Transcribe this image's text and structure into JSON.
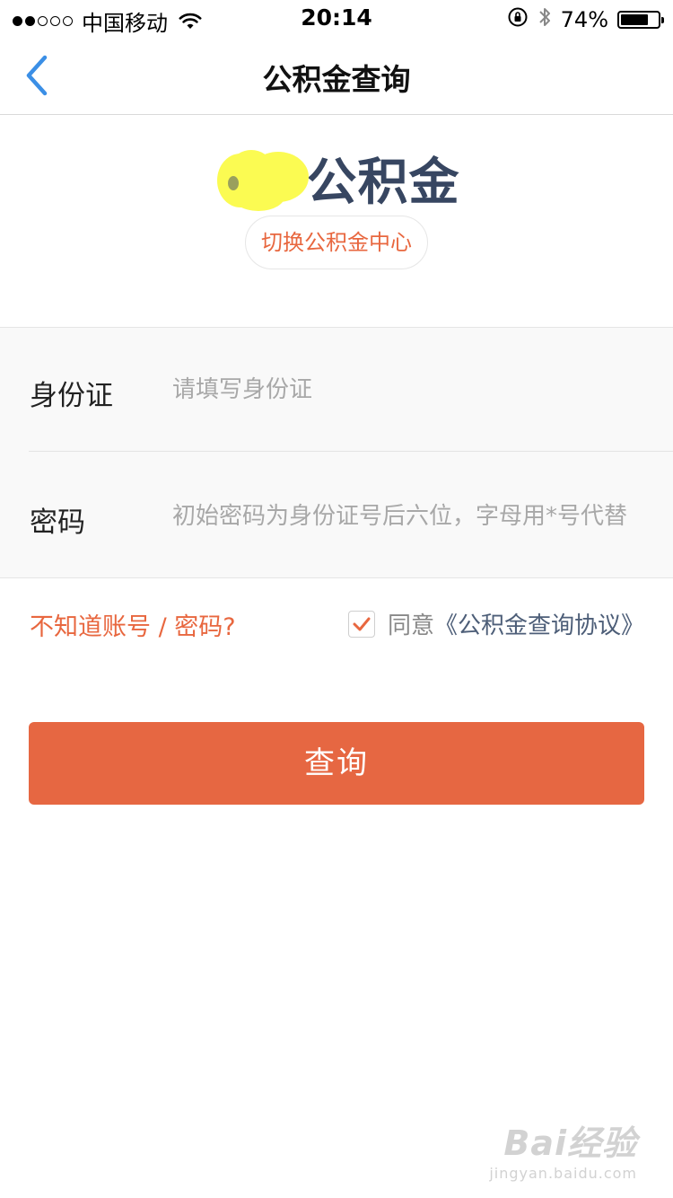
{
  "status_bar": {
    "carrier": "中国移动",
    "time": "20:14",
    "battery_text": "74%",
    "battery_level": 0.74
  },
  "nav": {
    "title": "公积金查询"
  },
  "brand": {
    "title": "公积金",
    "switch_center_label": "切换公积金中心"
  },
  "form": {
    "id_label": "身份证",
    "id_placeholder": "请填写身份证",
    "password_label": "密码",
    "password_placeholder": "初始密码为身份证号后六位，字母用*号代替"
  },
  "agreement": {
    "forgot_label": "不知道账号 / 密码?",
    "agree_text": "同意",
    "agreement_link": "《公积金查询协议》",
    "checked": true
  },
  "actions": {
    "query_label": "查询"
  },
  "watermark": {
    "logo_text": "Bai经验",
    "url": "jingyan.baidu.com"
  },
  "colors": {
    "accent": "#e66742",
    "brand_title": "#374661",
    "back_arrow": "#3b8fe6"
  }
}
